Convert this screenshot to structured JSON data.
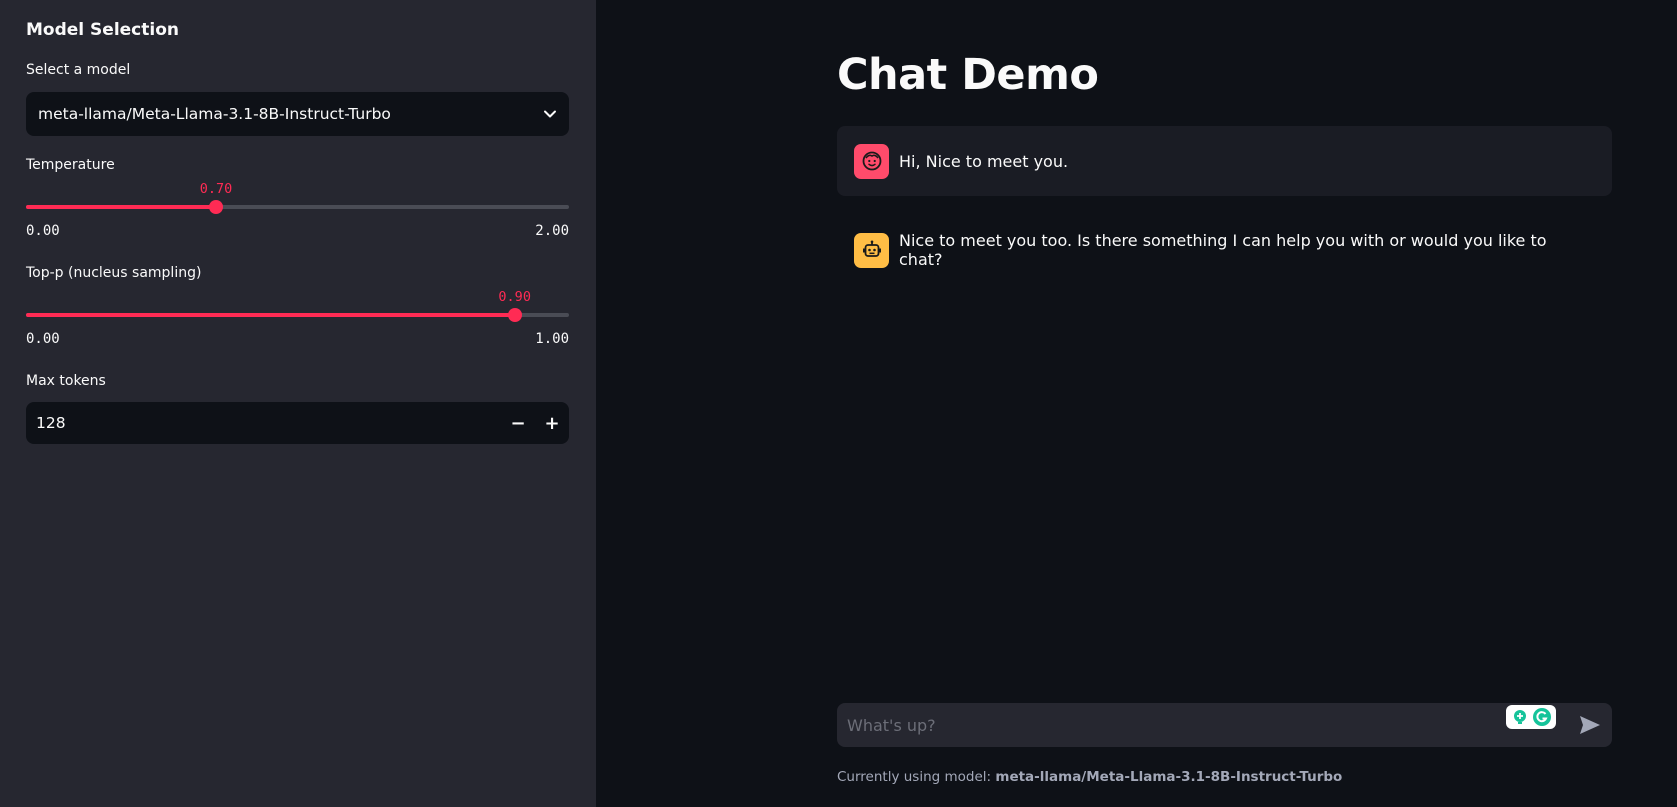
{
  "sidebar": {
    "title": "Model Selection",
    "model_select": {
      "label": "Select a model",
      "value": "meta-llama/Meta-Llama-3.1-8B-Instruct-Turbo"
    },
    "temperature": {
      "label": "Temperature",
      "value": 0.7,
      "value_text": "0.70",
      "min_text": "0.00",
      "max_text": "2.00",
      "min": 0,
      "max": 2
    },
    "top_p": {
      "label": "Top-p (nucleus sampling)",
      "value": 0.9,
      "value_text": "0.90",
      "min_text": "0.00",
      "max_text": "1.00",
      "min": 0,
      "max": 1
    },
    "max_tokens": {
      "label": "Max tokens",
      "value": "128",
      "decrement_label": "−",
      "increment_label": "+"
    }
  },
  "main": {
    "title": "Chat Demo",
    "messages": [
      {
        "role": "user",
        "avatar_icon": "user-face-icon",
        "text": "Hi, Nice to meet you."
      },
      {
        "role": "assistant",
        "avatar_icon": "robot-icon",
        "text": "Nice to meet you too. Is there something I can help you with or would you like to chat?"
      }
    ],
    "chat_input": {
      "placeholder": "What's up?",
      "send_icon": "send-icon"
    },
    "footer": {
      "prefix": "Currently using model: ",
      "model": "meta-llama/Meta-Llama-3.1-8B-Instruct-Turbo"
    }
  },
  "colors": {
    "sidebar_bg": "#262730",
    "main_bg": "#0e1117",
    "accent": "#ff2b54",
    "user_avatar": "#ff4b6b",
    "bot_avatar": "#ffbd45",
    "grammarly": "#15c39a"
  }
}
